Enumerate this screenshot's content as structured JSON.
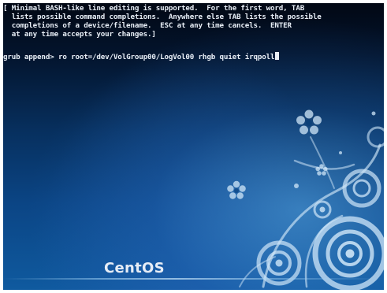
{
  "terminal": {
    "help_lines": [
      "[ Minimal BASH-like line editing is supported.  For the first word, TAB",
      "  lists possible command completions.  Anywhere else TAB lists the possible",
      "  completions of a device/filename.  ESC at any time cancels.  ENTER",
      "  at any time accepts your changes.]"
    ],
    "prompt": "grub append>",
    "command": "ro root=/dev/VolGroup00/LogVol00 rhgb quiet irqpoll"
  },
  "branding": {
    "logo_text": "CentOS"
  },
  "colors": {
    "background_dark": "#020814",
    "background_light": "#0f5a9f",
    "text": "#e8eef6",
    "ornament": "#cfe6f8"
  },
  "icons": [
    "swirl-ornament-icon",
    "flower-ornament-icon"
  ]
}
